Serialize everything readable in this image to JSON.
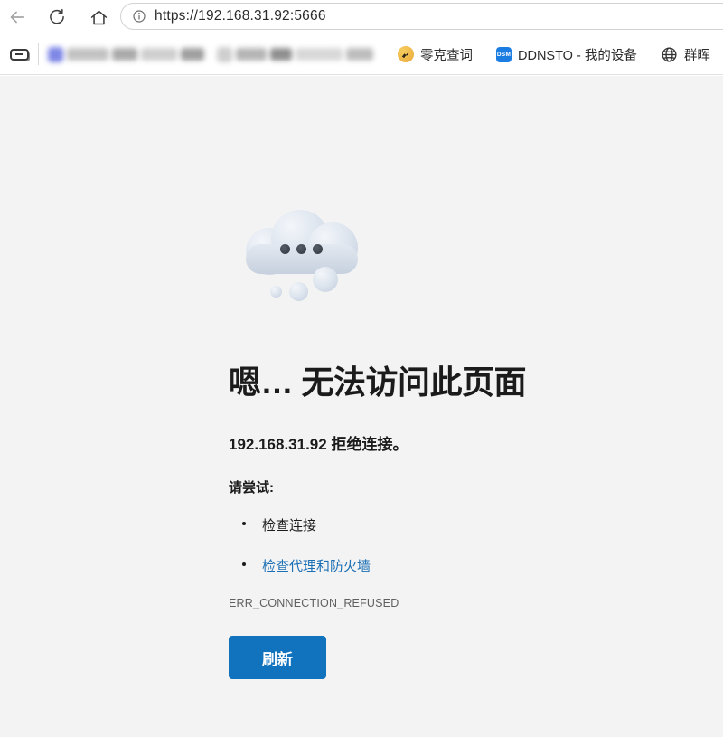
{
  "browser": {
    "toolbar": {
      "back_icon": "back-arrow",
      "refresh_icon": "refresh",
      "home_icon": "home",
      "address": {
        "security_icon": "info",
        "url": "https://192.168.31.92:5666"
      }
    },
    "bookmarks_bar": {
      "panel_icon": "favorites-panel",
      "redacted_bookmark_count": 2,
      "bookmarks": [
        {
          "label": "零克查词",
          "icon": "yellow-circle-favicon"
        },
        {
          "label": "DDNSTO - 我的设备",
          "icon": "dsm-badge",
          "icon_text": "DSM",
          "icon_color": "#1b7ce2"
        },
        {
          "label": "群晖",
          "icon": "globe"
        }
      ]
    }
  },
  "error_page": {
    "illustration": "cloud-with-dots-emoji",
    "title": "嗯… 无法访问此页面",
    "subtitle": "192.168.31.92 拒绝连接。",
    "suggestions_heading": "请尝试:",
    "suggestions": [
      {
        "label": "检查连接",
        "is_link": false
      },
      {
        "label": "检查代理和防火墙",
        "is_link": true
      }
    ],
    "error_code": "ERR_CONNECTION_REFUSED",
    "refresh_button_label": "刷新",
    "colors": {
      "background": "#f3f3f3",
      "button": "#1173bd",
      "link": "#1b6fb5",
      "text": "#1b1b1b"
    }
  }
}
